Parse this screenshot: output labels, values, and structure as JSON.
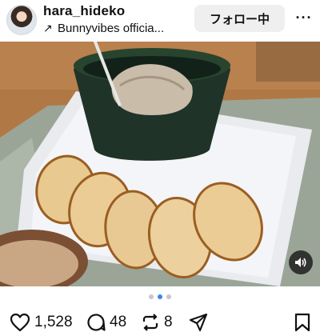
{
  "post": {
    "username": "hara_hideko",
    "subline_arrow_icon": "arrow-up-right-icon",
    "subline": "Bunnyvibes officia...",
    "follow_label": "フォロー中",
    "more_icon": "more-dots-icon",
    "more_label": "···"
  },
  "carousel": {
    "total": 3,
    "active_index": 2
  },
  "actions": {
    "likes": "1,528",
    "comments": "48",
    "reposts": "8"
  },
  "colors": {
    "active_dot": "#3b82f6",
    "inactive_dot": "#c7c7c7",
    "follow_bg": "#efefef"
  }
}
